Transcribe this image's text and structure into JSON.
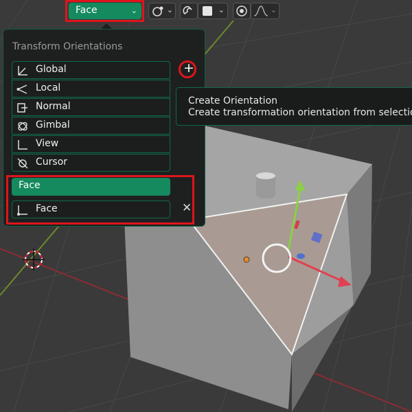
{
  "header": {
    "orientation_value": "Face"
  },
  "popup": {
    "title": "Transform Orientations",
    "items": [
      {
        "label": "Global",
        "icon": "orientation-global-icon"
      },
      {
        "label": "Local",
        "icon": "orientation-local-icon"
      },
      {
        "label": "Normal",
        "icon": "orientation-normal-icon"
      },
      {
        "label": "Gimbal",
        "icon": "orientation-gimbal-icon"
      },
      {
        "label": "View",
        "icon": "orientation-view-icon"
      },
      {
        "label": "Cursor",
        "icon": "orientation-cursor-icon"
      }
    ],
    "add_icon": "plus-icon",
    "custom": {
      "name_value": "Face",
      "item_label": "Face",
      "delete_icon": "close-icon"
    }
  },
  "tooltip": {
    "title": "Create Orientation",
    "description": "Create transformation orientation from selection"
  },
  "colors": {
    "accent_green": "#148a5e",
    "highlight_red": "#e0141b",
    "viewport_bg": "#3a3a3a",
    "popup_bg": "#1e2020"
  }
}
